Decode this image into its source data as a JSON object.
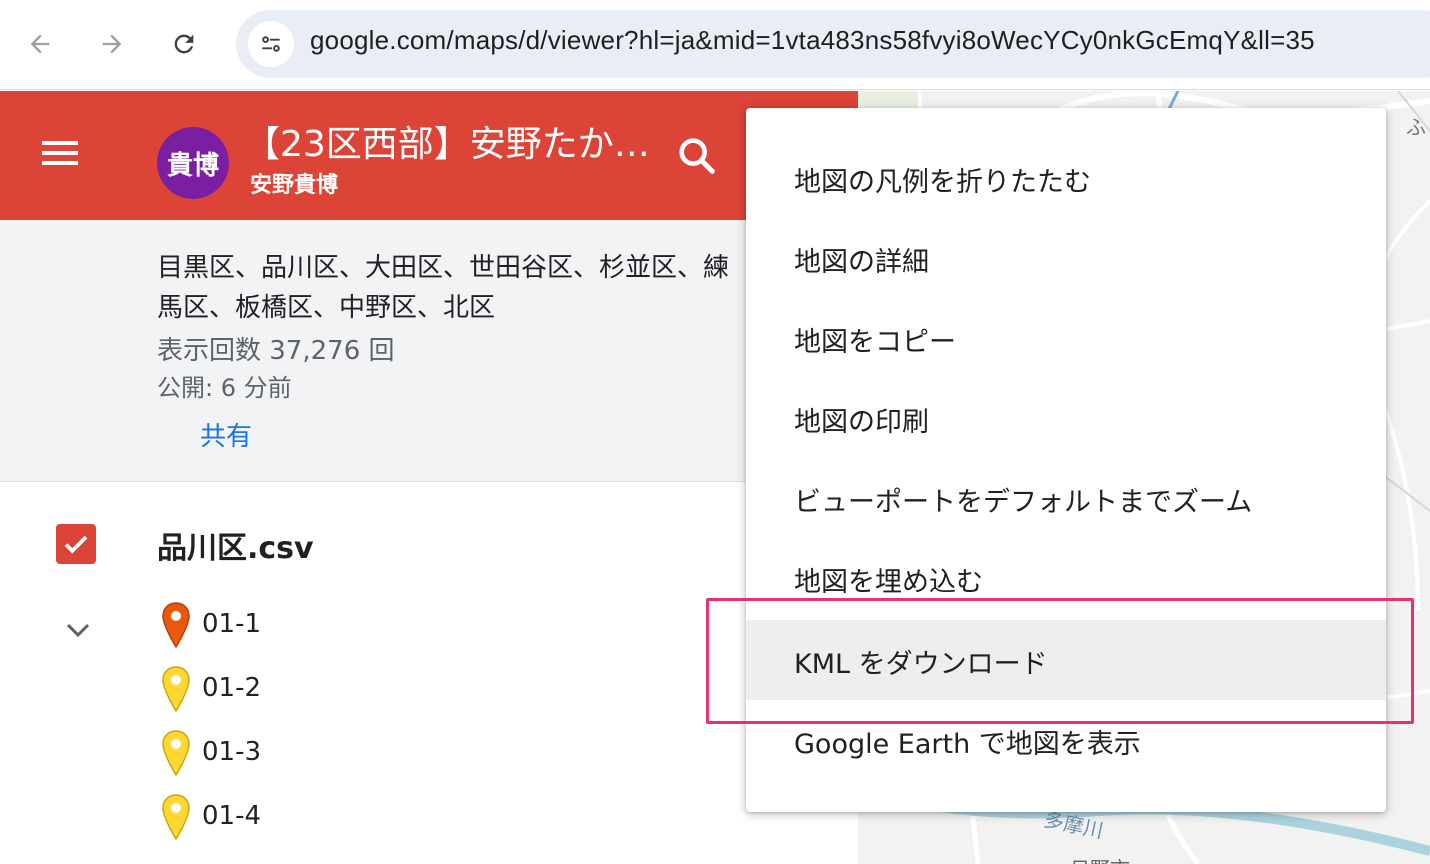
{
  "browser": {
    "url": "google.com/maps/d/viewer?hl=ja&mid=1vta483ns58fvyi8oWecYCy0nkGcEmqY&ll=35"
  },
  "header": {
    "avatar_text": "貴博",
    "title": "【23区西部】安野たか…",
    "owner": "安野貴博",
    "accent_color": "#db4437"
  },
  "info": {
    "description": "目黒区、品川区、大田区、世田谷区、杉並区、練馬区、板橋区、中野区、北区",
    "views": "表示回数 37,276 回",
    "published": "公開: 6 分前",
    "share_label": "共有"
  },
  "layer": {
    "name": "品川区.csv",
    "checked": true
  },
  "places": [
    {
      "label": "01-1",
      "color": "#e8590c"
    },
    {
      "label": "01-2",
      "color": "#fdd835"
    },
    {
      "label": "01-3",
      "color": "#fdd835"
    },
    {
      "label": "01-4",
      "color": "#fdd835"
    }
  ],
  "map": {
    "labels": [
      "ふ",
      "多摩川",
      "日野市"
    ]
  },
  "menu": {
    "items": [
      "地図の凡例を折りたたむ",
      "地図の詳細",
      "地図をコピー",
      "地図の印刷",
      "ビューポートをデフォルトまでズーム",
      "地図を埋め込む",
      "KML をダウンロード",
      "Google Earth で地図を表示"
    ],
    "hovered_index": 6
  },
  "annotation": {
    "highlight_color": "#e8326b"
  }
}
